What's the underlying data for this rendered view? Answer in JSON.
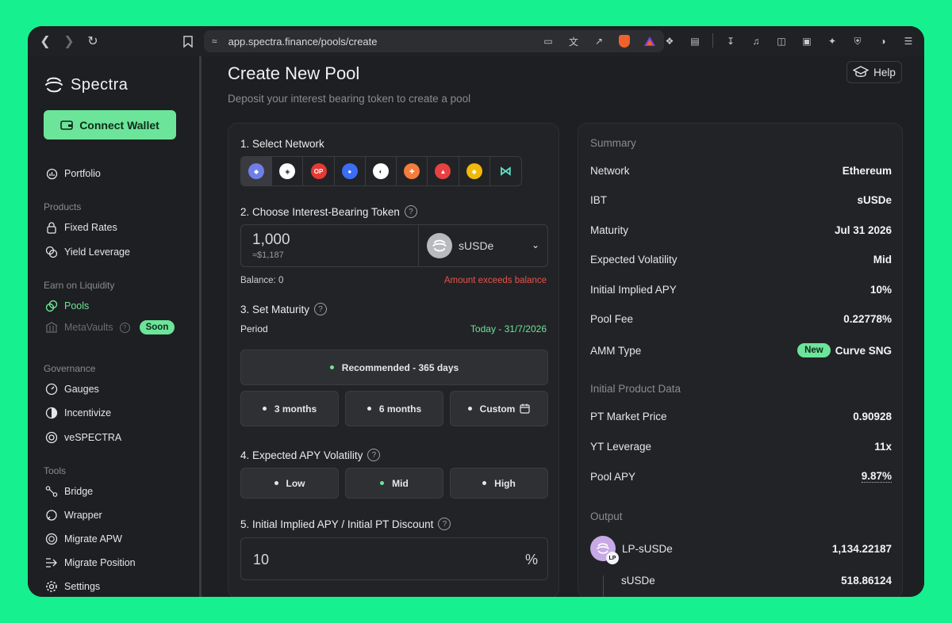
{
  "browser": {
    "url": "app.spectra.finance/pools/create"
  },
  "sidebar": {
    "brand": "Spectra",
    "connect_label": "Connect Wallet",
    "portfolio": "Portfolio",
    "groups": {
      "products": "Products",
      "earn": "Earn on Liquidity",
      "governance": "Governance",
      "tools": "Tools"
    },
    "items": {
      "fixed_rates": "Fixed Rates",
      "yield_leverage": "Yield Leverage",
      "pools": "Pools",
      "metavaults": "MetaVaults",
      "soon": "Soon",
      "gauges": "Gauges",
      "incentivize": "Incentivize",
      "vespectra": "veSPECTRA",
      "bridge": "Bridge",
      "wrapper": "Wrapper",
      "migrate_apw": "Migrate APW",
      "migrate_position": "Migrate Position",
      "settings": "Settings"
    }
  },
  "header": {
    "title": "Create New Pool",
    "subtitle": "Deposit your interest bearing token to create a pool",
    "help": "Help"
  },
  "form": {
    "step1": "1. Select Network",
    "networks": [
      {
        "name": "ethereum-icon",
        "color": "#6f7ee8",
        "glyph": "◆"
      },
      {
        "name": "arbitrum-icon",
        "color": "#ffffff",
        "glyph": "◈"
      },
      {
        "name": "optimism-icon",
        "color": "#e53935",
        "glyph": "OP"
      },
      {
        "name": "base-icon",
        "color": "#3b6df5",
        "glyph": "●"
      },
      {
        "name": "sonic-icon",
        "color": "#ffffff",
        "glyph": "◐"
      },
      {
        "name": "hemi-icon",
        "color": "#f47c3c",
        "glyph": "✚"
      },
      {
        "name": "avalanche-icon",
        "color": "#e84142",
        "glyph": "▲"
      },
      {
        "name": "bnb-icon",
        "color": "#f0b90b",
        "glyph": "◆"
      },
      {
        "name": "katana-icon",
        "color": "#5de0c7",
        "glyph": "⋈"
      }
    ],
    "step2": "2. Choose Interest-Bearing Token",
    "amount": "1,000",
    "amount_usd": "≈$1,187",
    "token": "sUSDe",
    "balance": "Balance: 0",
    "error": "Amount exceeds balance",
    "step3": "3. Set Maturity",
    "period_label": "Period",
    "period_value": "Today - 31/7/2026",
    "recommended": "Recommended - 365 days",
    "m3": "3 months",
    "m6": "6 months",
    "custom": "Custom",
    "step4": "4. Expected APY Volatility",
    "low": "Low",
    "mid": "Mid",
    "high": "High",
    "step5": "5. Initial Implied APY / Initial PT Discount",
    "apy_value": "10",
    "apy_unit": "%"
  },
  "summary": {
    "title": "Summary",
    "rows": [
      {
        "key": "Network",
        "val": "Ethereum"
      },
      {
        "key": "IBT",
        "val": "sUSDe"
      },
      {
        "key": "Maturity",
        "val": "Jul 31 2026"
      },
      {
        "key": "Expected Volatility",
        "val": "Mid"
      },
      {
        "key": "Initial Implied APY",
        "val": "10%"
      },
      {
        "key": "Pool Fee",
        "val": "0.22778%"
      },
      {
        "key": "AMM Type",
        "val": "Curve SNG",
        "badge": "New"
      }
    ],
    "product_title": "Initial Product Data",
    "product_rows": [
      {
        "key": "PT Market Price",
        "val": "0.90928"
      },
      {
        "key": "YT Leverage",
        "val": "11x"
      },
      {
        "key": "Pool APY",
        "val": "9.87%"
      }
    ],
    "output_title": "Output",
    "lp_name": "LP-sUSDe",
    "lp_value": "1,134.22187",
    "lp_tag": "LP",
    "sub_name": "sUSDe",
    "sub_value": "518.86124"
  }
}
